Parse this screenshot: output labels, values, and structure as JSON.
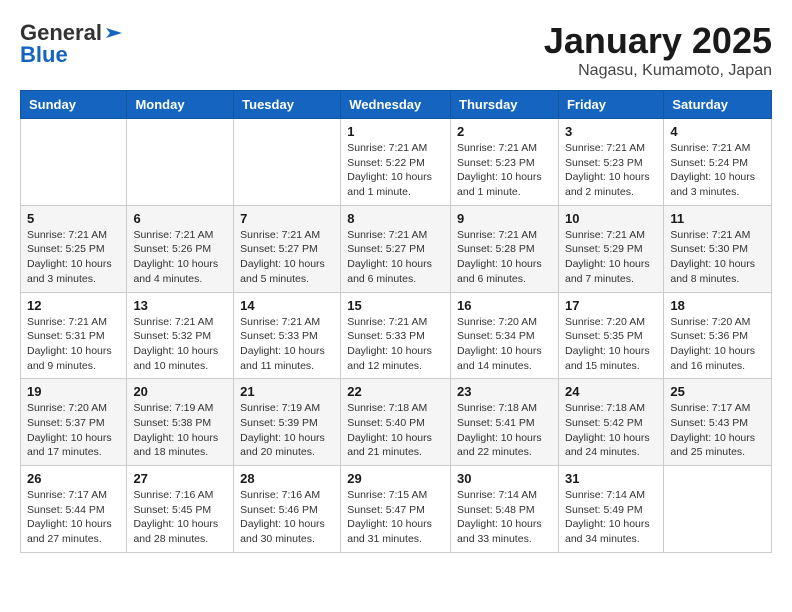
{
  "header": {
    "logo_general": "General",
    "logo_blue": "Blue",
    "month_title": "January 2025",
    "location": "Nagasu, Kumamoto, Japan"
  },
  "days_of_week": [
    "Sunday",
    "Monday",
    "Tuesday",
    "Wednesday",
    "Thursday",
    "Friday",
    "Saturday"
  ],
  "weeks": [
    [
      {
        "day": "",
        "info": ""
      },
      {
        "day": "",
        "info": ""
      },
      {
        "day": "",
        "info": ""
      },
      {
        "day": "1",
        "info": "Sunrise: 7:21 AM\nSunset: 5:22 PM\nDaylight: 10 hours\nand 1 minute."
      },
      {
        "day": "2",
        "info": "Sunrise: 7:21 AM\nSunset: 5:23 PM\nDaylight: 10 hours\nand 1 minute."
      },
      {
        "day": "3",
        "info": "Sunrise: 7:21 AM\nSunset: 5:23 PM\nDaylight: 10 hours\nand 2 minutes."
      },
      {
        "day": "4",
        "info": "Sunrise: 7:21 AM\nSunset: 5:24 PM\nDaylight: 10 hours\nand 3 minutes."
      }
    ],
    [
      {
        "day": "5",
        "info": "Sunrise: 7:21 AM\nSunset: 5:25 PM\nDaylight: 10 hours\nand 3 minutes."
      },
      {
        "day": "6",
        "info": "Sunrise: 7:21 AM\nSunset: 5:26 PM\nDaylight: 10 hours\nand 4 minutes."
      },
      {
        "day": "7",
        "info": "Sunrise: 7:21 AM\nSunset: 5:27 PM\nDaylight: 10 hours\nand 5 minutes."
      },
      {
        "day": "8",
        "info": "Sunrise: 7:21 AM\nSunset: 5:27 PM\nDaylight: 10 hours\nand 6 minutes."
      },
      {
        "day": "9",
        "info": "Sunrise: 7:21 AM\nSunset: 5:28 PM\nDaylight: 10 hours\nand 6 minutes."
      },
      {
        "day": "10",
        "info": "Sunrise: 7:21 AM\nSunset: 5:29 PM\nDaylight: 10 hours\nand 7 minutes."
      },
      {
        "day": "11",
        "info": "Sunrise: 7:21 AM\nSunset: 5:30 PM\nDaylight: 10 hours\nand 8 minutes."
      }
    ],
    [
      {
        "day": "12",
        "info": "Sunrise: 7:21 AM\nSunset: 5:31 PM\nDaylight: 10 hours\nand 9 minutes."
      },
      {
        "day": "13",
        "info": "Sunrise: 7:21 AM\nSunset: 5:32 PM\nDaylight: 10 hours\nand 10 minutes."
      },
      {
        "day": "14",
        "info": "Sunrise: 7:21 AM\nSunset: 5:33 PM\nDaylight: 10 hours\nand 11 minutes."
      },
      {
        "day": "15",
        "info": "Sunrise: 7:21 AM\nSunset: 5:33 PM\nDaylight: 10 hours\nand 12 minutes."
      },
      {
        "day": "16",
        "info": "Sunrise: 7:20 AM\nSunset: 5:34 PM\nDaylight: 10 hours\nand 14 minutes."
      },
      {
        "day": "17",
        "info": "Sunrise: 7:20 AM\nSunset: 5:35 PM\nDaylight: 10 hours\nand 15 minutes."
      },
      {
        "day": "18",
        "info": "Sunrise: 7:20 AM\nSunset: 5:36 PM\nDaylight: 10 hours\nand 16 minutes."
      }
    ],
    [
      {
        "day": "19",
        "info": "Sunrise: 7:20 AM\nSunset: 5:37 PM\nDaylight: 10 hours\nand 17 minutes."
      },
      {
        "day": "20",
        "info": "Sunrise: 7:19 AM\nSunset: 5:38 PM\nDaylight: 10 hours\nand 18 minutes."
      },
      {
        "day": "21",
        "info": "Sunrise: 7:19 AM\nSunset: 5:39 PM\nDaylight: 10 hours\nand 20 minutes."
      },
      {
        "day": "22",
        "info": "Sunrise: 7:18 AM\nSunset: 5:40 PM\nDaylight: 10 hours\nand 21 minutes."
      },
      {
        "day": "23",
        "info": "Sunrise: 7:18 AM\nSunset: 5:41 PM\nDaylight: 10 hours\nand 22 minutes."
      },
      {
        "day": "24",
        "info": "Sunrise: 7:18 AM\nSunset: 5:42 PM\nDaylight: 10 hours\nand 24 minutes."
      },
      {
        "day": "25",
        "info": "Sunrise: 7:17 AM\nSunset: 5:43 PM\nDaylight: 10 hours\nand 25 minutes."
      }
    ],
    [
      {
        "day": "26",
        "info": "Sunrise: 7:17 AM\nSunset: 5:44 PM\nDaylight: 10 hours\nand 27 minutes."
      },
      {
        "day": "27",
        "info": "Sunrise: 7:16 AM\nSunset: 5:45 PM\nDaylight: 10 hours\nand 28 minutes."
      },
      {
        "day": "28",
        "info": "Sunrise: 7:16 AM\nSunset: 5:46 PM\nDaylight: 10 hours\nand 30 minutes."
      },
      {
        "day": "29",
        "info": "Sunrise: 7:15 AM\nSunset: 5:47 PM\nDaylight: 10 hours\nand 31 minutes."
      },
      {
        "day": "30",
        "info": "Sunrise: 7:14 AM\nSunset: 5:48 PM\nDaylight: 10 hours\nand 33 minutes."
      },
      {
        "day": "31",
        "info": "Sunrise: 7:14 AM\nSunset: 5:49 PM\nDaylight: 10 hours\nand 34 minutes."
      },
      {
        "day": "",
        "info": ""
      }
    ]
  ]
}
